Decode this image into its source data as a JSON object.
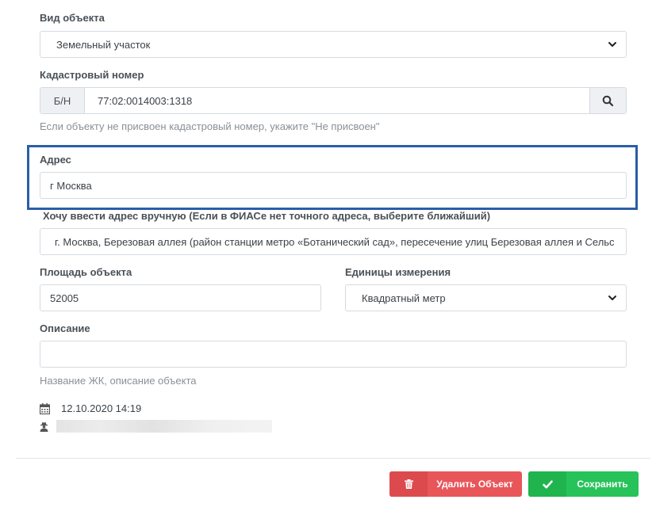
{
  "object_type": {
    "label": "Вид объекта",
    "value": "Земельный участок"
  },
  "cadastral": {
    "label": "Кадастровый номер",
    "prefix": "Б/Н",
    "value": "77:02:0014003:1318",
    "hint": "Если объекту не присвоен кадастровый номер, укажите \"Не присвоен\""
  },
  "address": {
    "label": "Адрес",
    "value": "г Москва"
  },
  "manual_address": {
    "label": "Хочу ввести адрес вручную (Если в ФИАСе нет точного адреса, выберите ближайший)",
    "value": "г. Москва, Березовая аллея (район станции метро «Ботанический сад», пересечение улиц Березовая аллея и Сельс"
  },
  "area": {
    "label": "Площадь объекта",
    "value": "52005"
  },
  "units": {
    "label": "Единицы измерения",
    "value": "Квадратный метр"
  },
  "description": {
    "label": "Описание",
    "value": "",
    "hint": "Название ЖК, описание объекта"
  },
  "meta": {
    "date": "12.10.2020 14:19"
  },
  "actions": {
    "delete_label": "Удалить Объект",
    "save_label": "Сохранить"
  },
  "colors": {
    "highlight_border": "#2a5ea8",
    "delete_button": "#e8565a",
    "save_button": "#27c25a"
  },
  "icons": {
    "select_arrow": "chevron-down-icon",
    "search": "search-icon",
    "date": "calendar-icon",
    "author": "user-secret-icon",
    "delete": "trash-icon",
    "save": "check-icon"
  }
}
